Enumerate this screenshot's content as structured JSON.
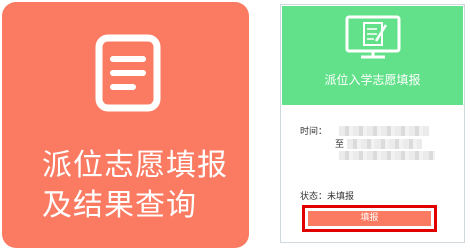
{
  "left_tile": {
    "title_line1": "派位志愿填报",
    "title_line2": "及结果查询",
    "icon": "document-icon",
    "card_color": "#fb7b62"
  },
  "right_panel": {
    "header_title": "派位入学志愿填报",
    "header_icon": "tablet-pen-icon",
    "header_color": "#62e18a",
    "time_label": "时间：",
    "to_label": "至",
    "status_label": "状态：未填报",
    "fill_button_label": "填报",
    "button_color": "#fb7b62",
    "highlight_color": "#e10000"
  }
}
